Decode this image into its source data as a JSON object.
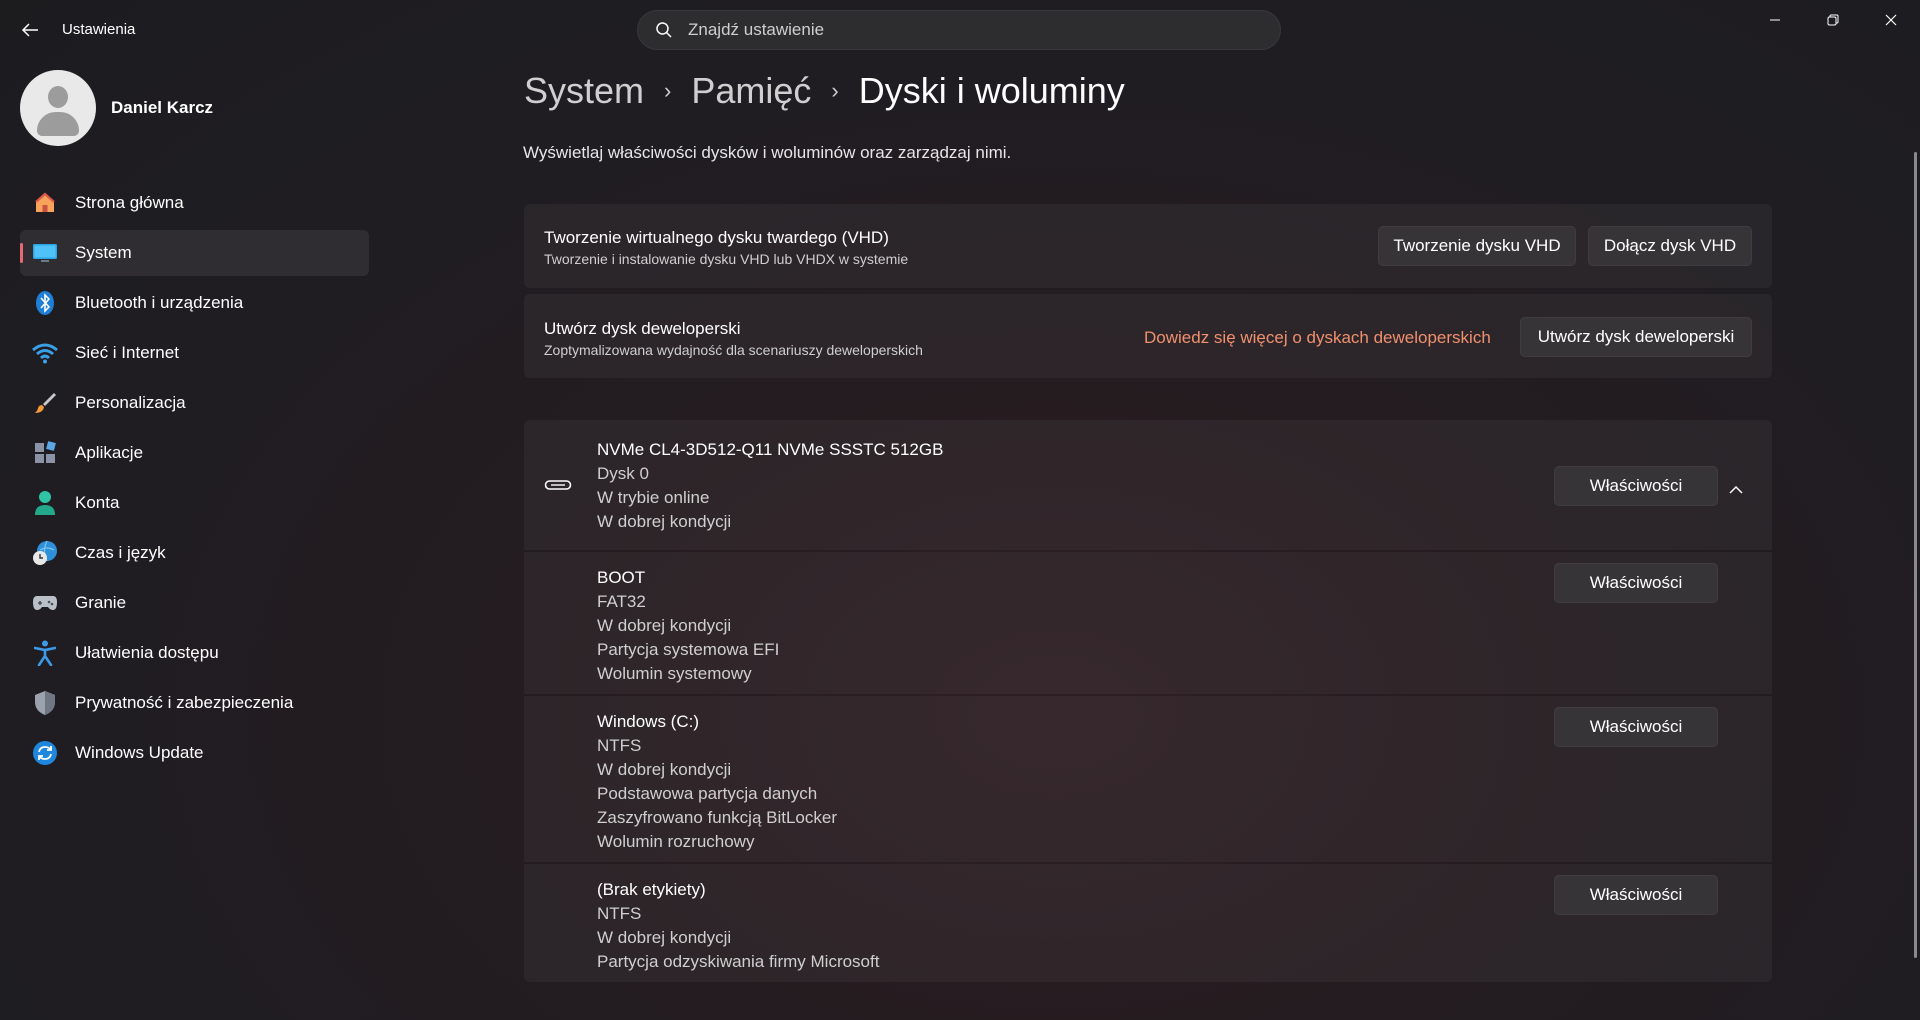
{
  "window": {
    "app_title": "Ustawienia",
    "search_placeholder": "Znajdź ustawienie"
  },
  "user": {
    "name": "Daniel Karcz"
  },
  "sidebar": {
    "items": [
      {
        "label": "Strona główna",
        "icon": "home-icon",
        "active": false
      },
      {
        "label": "System",
        "icon": "system-display-icon",
        "active": true
      },
      {
        "label": "Bluetooth i urządzenia",
        "icon": "bluetooth-icon",
        "active": false
      },
      {
        "label": "Sieć i Internet",
        "icon": "wifi-icon",
        "active": false
      },
      {
        "label": "Personalizacja",
        "icon": "brush-icon",
        "active": false
      },
      {
        "label": "Aplikacje",
        "icon": "apps-icon",
        "active": false
      },
      {
        "label": "Konta",
        "icon": "account-icon",
        "active": false
      },
      {
        "label": "Czas i język",
        "icon": "time-language-icon",
        "active": false
      },
      {
        "label": "Granie",
        "icon": "gamepad-icon",
        "active": false
      },
      {
        "label": "Ułatwienia dostępu",
        "icon": "accessibility-icon",
        "active": false
      },
      {
        "label": "Prywatność i zabezpieczenia",
        "icon": "shield-icon",
        "active": false
      },
      {
        "label": "Windows Update",
        "icon": "windows-update-icon",
        "active": false
      }
    ]
  },
  "breadcrumb": [
    "System",
    "Pamięć",
    "Dyski i woluminy"
  ],
  "page": {
    "subtitle": "Wyświetlaj właściwości dysków i woluminów oraz zarządzaj nimi."
  },
  "vhd_card": {
    "title": "Tworzenie wirtualnego dysku twardego (VHD)",
    "description": "Tworzenie i instalowanie dysku VHD lub VHDX w systemie",
    "create_button": "Tworzenie dysku VHD",
    "attach_button": "Dołącz dysk VHD"
  },
  "dev_card": {
    "title": "Utwórz dysk deweloperski",
    "description": "Zoptymalizowana wydajność dla scenariuszy deweloperskich",
    "learn_more_link": "Dowiedz się więcej o dyskach deweloperskich",
    "create_button": "Utwórz dysk deweloperski"
  },
  "disk": {
    "name": "NVMe CL4-3D512-Q11 NVMe SSSTC 512GB",
    "details": [
      "Dysk 0",
      "W trybie online",
      "W dobrej kondycji"
    ],
    "properties_button": "Właściwości",
    "expanded": true
  },
  "volumes": [
    {
      "name": "BOOT",
      "details": [
        "FAT32",
        "W dobrej kondycji",
        "Partycja systemowa EFI",
        "Wolumin systemowy"
      ],
      "properties_button": "Właściwości"
    },
    {
      "name": "Windows (C:)",
      "details": [
        "NTFS",
        "W dobrej kondycji",
        "Podstawowa partycja danych",
        "Zaszyfrowano funkcją BitLocker",
        "Wolumin rozruchowy"
      ],
      "properties_button": "Właściwości"
    },
    {
      "name": "(Brak etykiety)",
      "details": [
        "NTFS",
        "W dobrej kondycji",
        "Partycja odzyskiwania firmy Microsoft"
      ],
      "properties_button": "Właściwości"
    }
  ],
  "colors": {
    "accent": "#e36a72",
    "link": "#f0906d",
    "background": "#1f1d22"
  }
}
